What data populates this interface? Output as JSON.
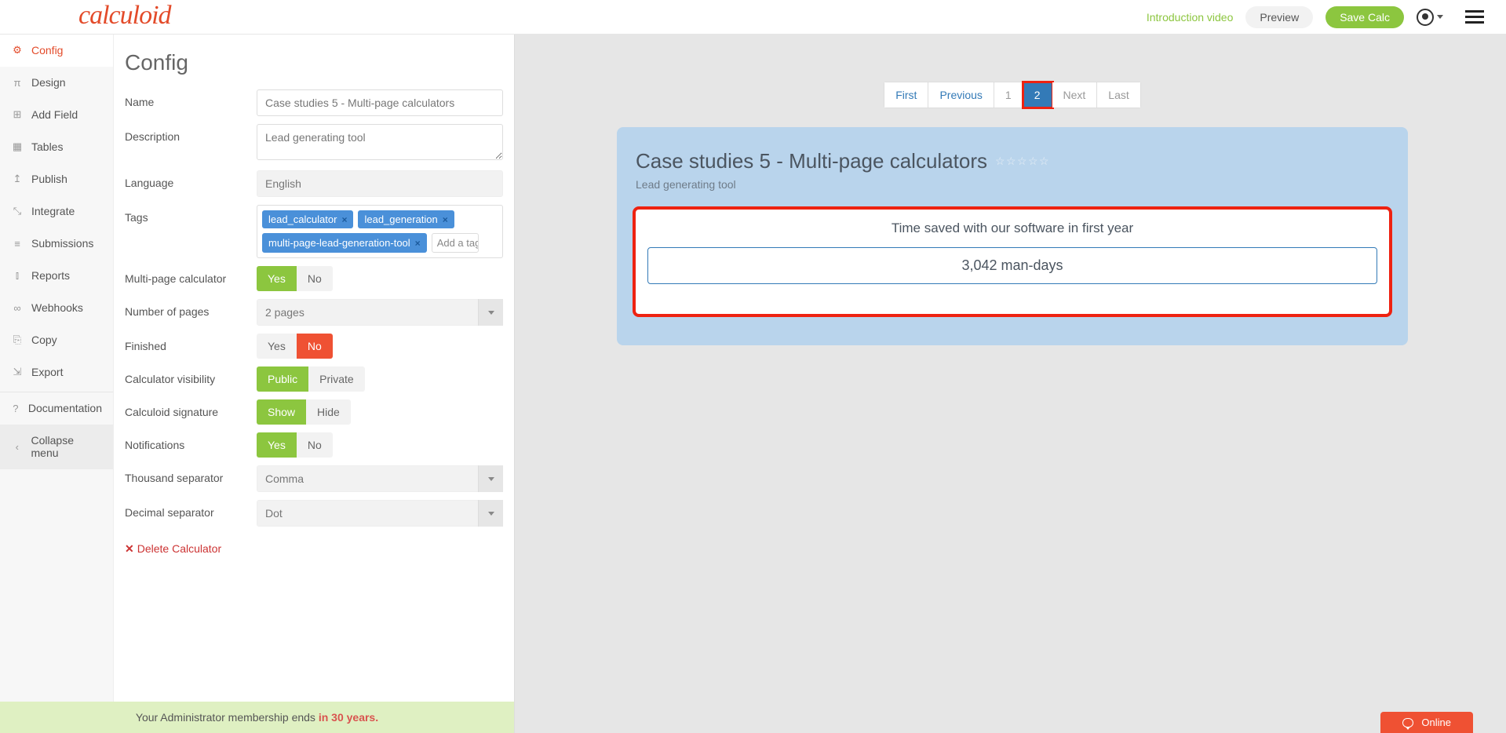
{
  "header": {
    "logo_text": "calculoid",
    "intro_link": "Introduction video",
    "preview_label": "Preview",
    "save_label": "Save Calc"
  },
  "sidebar": {
    "items": [
      {
        "icon": "⚙",
        "label": "Config",
        "name": "config",
        "active": true
      },
      {
        "icon": "π",
        "label": "Design",
        "name": "design"
      },
      {
        "icon": "⊞",
        "label": "Add Field",
        "name": "add-field"
      },
      {
        "icon": "▦",
        "label": "Tables",
        "name": "tables"
      },
      {
        "icon": "↥",
        "label": "Publish",
        "name": "publish"
      },
      {
        "icon": "⤡",
        "label": "Integrate",
        "name": "integrate"
      },
      {
        "icon": "≡",
        "label": "Submissions",
        "name": "submissions"
      },
      {
        "icon": "⫾",
        "label": "Reports",
        "name": "reports"
      },
      {
        "icon": "∞",
        "label": "Webhooks",
        "name": "webhooks"
      },
      {
        "icon": "⎘",
        "label": "Copy",
        "name": "copy"
      },
      {
        "icon": "⇲",
        "label": "Export",
        "name": "export"
      }
    ],
    "doc_icon": "?",
    "doc_label": "Documentation",
    "collapse_icon": "‹",
    "collapse_label": "Collapse menu"
  },
  "config": {
    "title": "Config",
    "name_label": "Name",
    "name_value": "Case studies 5 - Multi-page calculators",
    "desc_label": "Description",
    "desc_value": "Lead generating tool",
    "lang_label": "Language",
    "lang_value": "English",
    "tags_label": "Tags",
    "tags": [
      "lead_calculator",
      "lead_generation",
      "multi-page-lead-generation-tool"
    ],
    "tag_add_placeholder": "Add a tag",
    "multipage_label": "Multi-page calculator",
    "yes": "Yes",
    "no": "No",
    "num_pages_label": "Number of pages",
    "num_pages_value": "2 pages",
    "finished_label": "Finished",
    "visibility_label": "Calculator visibility",
    "public": "Public",
    "private": "Private",
    "sig_label": "Calculoid signature",
    "show": "Show",
    "hide": "Hide",
    "notif_label": "Notifications",
    "thou_label": "Thousand separator",
    "thou_value": "Comma",
    "dec_label": "Decimal separator",
    "dec_value": "Dot",
    "delete_label": "Delete Calculator"
  },
  "banner": {
    "pre": "Your Administrator membership ends ",
    "em": "in 30 years."
  },
  "preview": {
    "pager": {
      "first": "First",
      "prev": "Previous",
      "p1": "1",
      "p2": "2",
      "next": "Next",
      "last": "Last"
    },
    "card_title": "Case studies 5 - Multi-page calculators",
    "card_subtitle": "Lead generating tool",
    "result_heading": "Time saved with our software in first year",
    "result_value": "3,042 man-days"
  },
  "chat": {
    "label": "Online"
  }
}
